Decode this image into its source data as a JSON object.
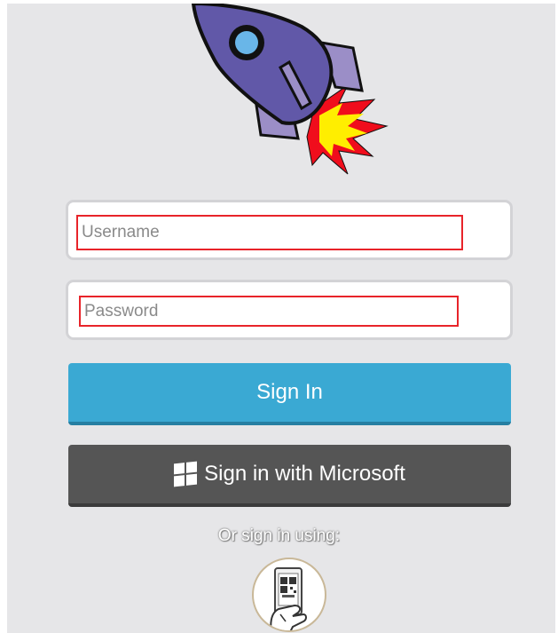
{
  "login": {
    "username_placeholder": "Username",
    "password_placeholder": "Password",
    "sign_in_label": "Sign In",
    "microsoft_label": "Sign in with Microsoft",
    "alt_signin_text": "Or sign in using:"
  },
  "icons": {
    "logo": "rocket-icon",
    "microsoft": "windows-logo-icon",
    "alt_signin": "qr-phone-icon"
  },
  "colors": {
    "sign_in_button": "#3aa9d3",
    "microsoft_button": "#555555",
    "field_highlight": "#e8242a",
    "background": "#e6e6e8"
  }
}
